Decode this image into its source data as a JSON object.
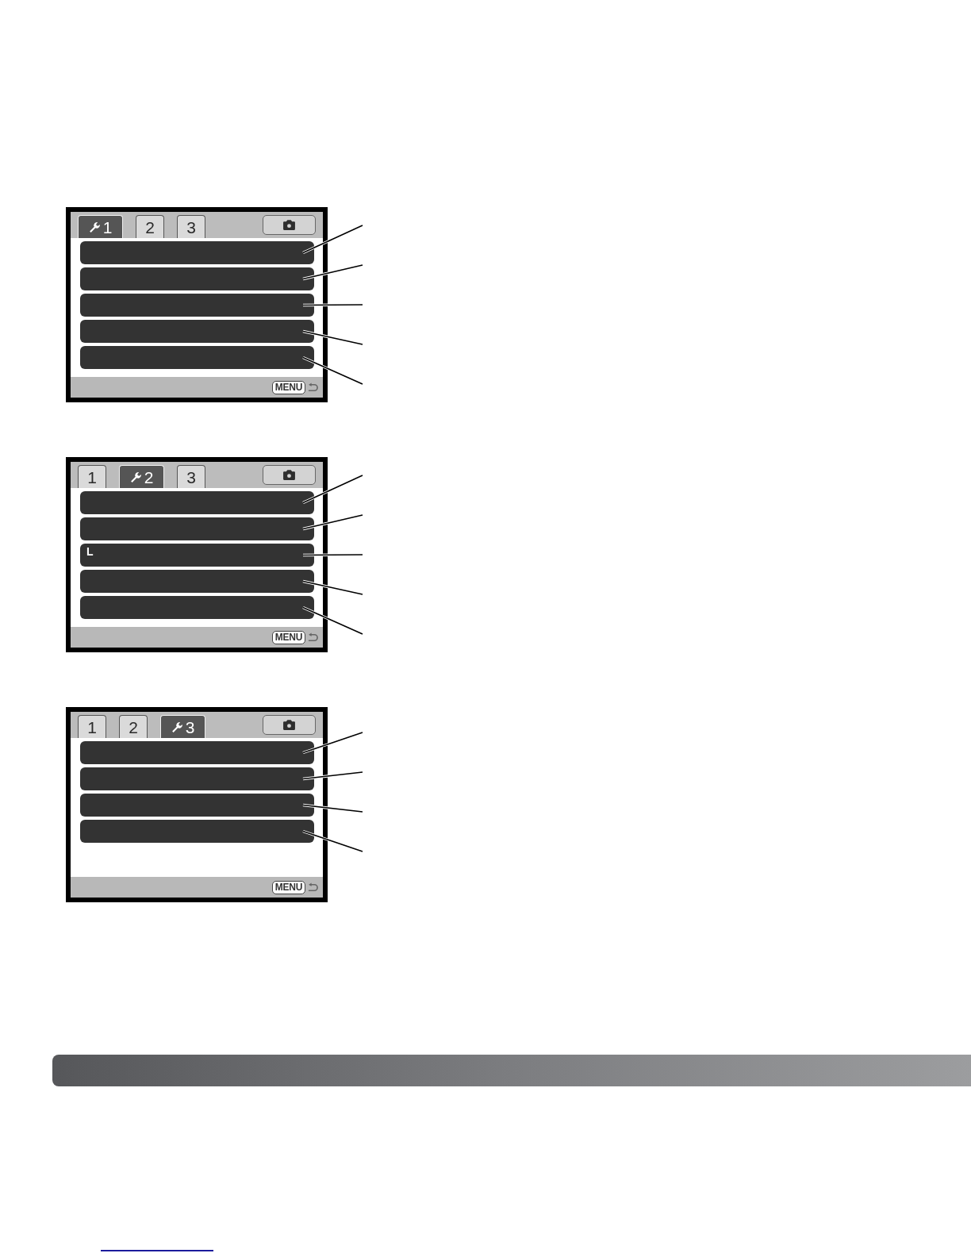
{
  "screens": [
    {
      "tabs": [
        {
          "label": "1",
          "selected": true
        },
        {
          "label": "2",
          "selected": false
        },
        {
          "label": "3",
          "selected": false
        }
      ],
      "rows": [
        {
          "callout": true
        },
        {
          "callout": true
        },
        {
          "callout": true
        },
        {
          "callout": true
        },
        {
          "callout": true
        }
      ],
      "hint": "MENU"
    },
    {
      "tabs": [
        {
          "label": "1",
          "selected": false
        },
        {
          "label": "2",
          "selected": true
        },
        {
          "label": "3",
          "selected": false
        }
      ],
      "rows": [
        {
          "callout": true
        },
        {
          "callout": true
        },
        {
          "label": "L",
          "callout": true
        },
        {
          "callout": true
        },
        {
          "callout": true
        }
      ],
      "hint": "MENU"
    },
    {
      "tabs": [
        {
          "label": "1",
          "selected": false
        },
        {
          "label": "2",
          "selected": false
        },
        {
          "label": "3",
          "selected": true
        }
      ],
      "rows": [
        {
          "callout": true
        },
        {
          "callout": true
        },
        {
          "callout": true
        },
        {
          "callout": true
        }
      ],
      "hint": "MENU"
    }
  ]
}
